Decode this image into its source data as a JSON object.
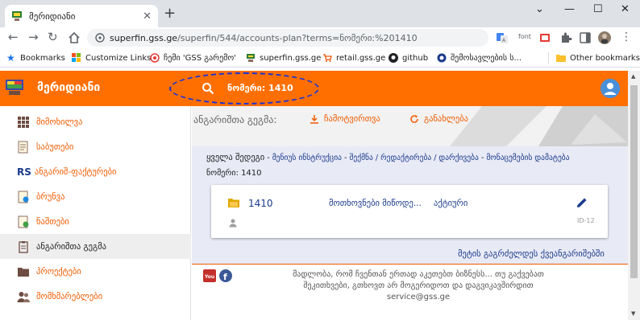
{
  "browser": {
    "tab_title": "მერიდიანი",
    "new_tab": "+",
    "window_controls": {
      "minimize": "—",
      "maximize": "☐",
      "close": "✕"
    },
    "url_host": "superfin.gss.ge",
    "url_rest": "/superfin/544/accounts-plan?terms=ნომერი:%201410",
    "bookmarks": [
      {
        "label": "Bookmarks"
      },
      {
        "label": "Customize Links"
      },
      {
        "label": "ჩემი 'GSS გარემო'"
      },
      {
        "label": "superfin.gss.ge"
      },
      {
        "label": "retail.gss.ge"
      },
      {
        "label": "github"
      },
      {
        "label": "შემოსავლების ს..."
      },
      {
        "label": "Other bookmarks"
      }
    ],
    "toolbar_text": "font"
  },
  "app": {
    "name": "მერიდიანი",
    "search_text": "ნომერი: 1410",
    "accent_color": "#ff6f00"
  },
  "sidebar": {
    "items": [
      {
        "label": "მიმოხილვა",
        "icon": "grid-icon"
      },
      {
        "label": "საბუთები",
        "icon": "documents-icon"
      },
      {
        "label": "ანგარიშ-ფაქტურები",
        "prefix": "RS",
        "icon": "rs-icon"
      },
      {
        "label": "ბრუნვა",
        "icon": "turnover-icon"
      },
      {
        "label": "ნაშთები",
        "icon": "balances-icon"
      },
      {
        "label": "ანგარიშთა გეგმა",
        "icon": "clipboard-icon",
        "active": true
      },
      {
        "label": "პროექტები",
        "icon": "folder-icon"
      },
      {
        "label": "მომხმარებლები",
        "icon": "users-icon"
      }
    ]
  },
  "main": {
    "title": "ანგარიშთა გეგმა:",
    "print_label": "ჩამოტვირთვა",
    "refresh_label": "განახლება",
    "crumbs": {
      "all": "ყველა შედეგი",
      "links": [
        "მენიუს ინსტრუქცია",
        "შექმნა / რედაქტირება / დარქივება",
        "მონაცემების დამატება"
      ],
      "separator": "-"
    },
    "filter_line": "ნომერი: 1410",
    "card": {
      "number": "1410",
      "name": "მოთხოვნები მიწოდე...",
      "status": "აქტიური",
      "id": "ID-12"
    },
    "more_link": "მეტის გაგრძელდეს ქვეანგარიშებში",
    "footer": {
      "line1": "მადლობა, რომ ჩვენთან ერთად აკეთებთ ბიზნესს... თუ გაქვებათ",
      "line2": "შეკითხვები, გთხოვთ არ მოგერიდოთ და დაგვიკავშირდით",
      "email": "service@gss.ge"
    }
  }
}
